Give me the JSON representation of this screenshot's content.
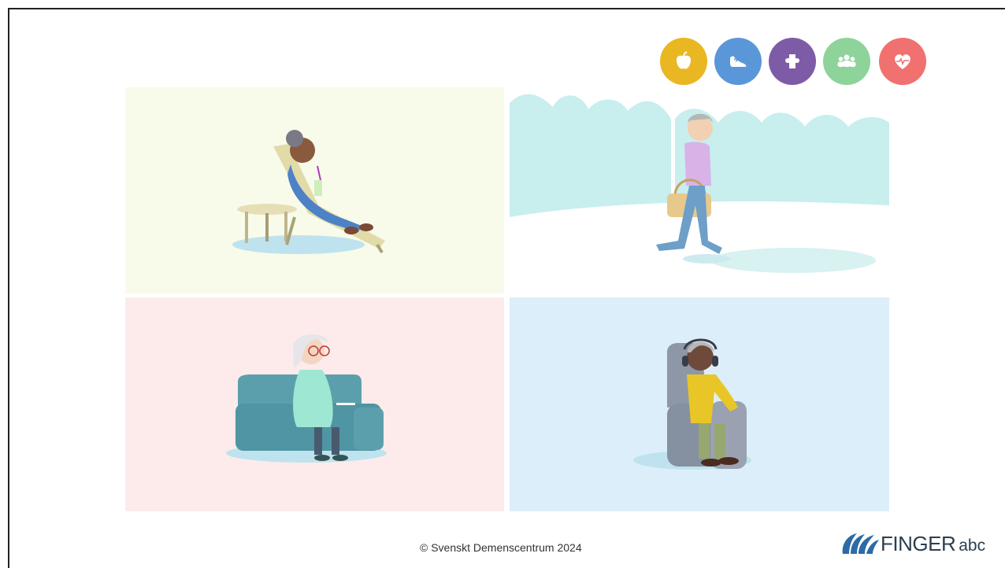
{
  "categories": [
    {
      "name": "nutrition",
      "icon": "apple-icon",
      "color": "#e8b722"
    },
    {
      "name": "physical-activity",
      "icon": "sneaker-icon",
      "color": "#5a97d8"
    },
    {
      "name": "cognitive-training",
      "icon": "puzzle-icon",
      "color": "#7e5ba6"
    },
    {
      "name": "social-activity",
      "icon": "people-icon",
      "color": "#8ed39a"
    },
    {
      "name": "vascular-health",
      "icon": "heart-pulse-icon",
      "color": "#f0716f"
    }
  ],
  "selected_category": "social-activity",
  "panels": [
    {
      "name": "panel-lounge-chair",
      "bg": "#f8fbea"
    },
    {
      "name": "panel-walking-basket",
      "bg": "#dff3f3"
    },
    {
      "name": "panel-sofa-writing",
      "bg": "#fdebeb"
    },
    {
      "name": "panel-armchair-headphones",
      "bg": "#ddeefb"
    }
  ],
  "footer": {
    "copyright": "© Svenskt Demenscentrum 2024"
  },
  "logo": {
    "word": "FINGER",
    "suffix": "abc",
    "color": "#2c3e50"
  }
}
